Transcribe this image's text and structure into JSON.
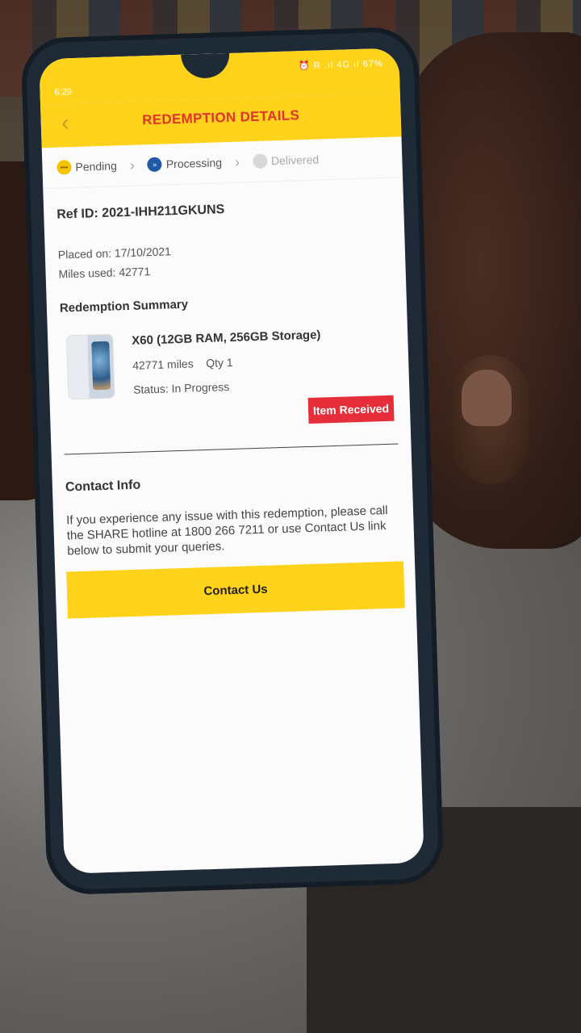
{
  "status_bar": {
    "time": "6:29",
    "icons": "⏰ R .ıl 4G ıl  67%",
    "battery": "67%"
  },
  "header": {
    "title": "REDEMPTION DETAILS",
    "back_icon": "chevron-left-icon"
  },
  "steps": [
    {
      "label": "Pending",
      "state": "complete"
    },
    {
      "label": "Processing",
      "state": "active"
    },
    {
      "label": "Delivered",
      "state": "inactive"
    }
  ],
  "order": {
    "ref": "Ref ID: 2021-IHH211GKUNS",
    "placed_on": "Placed on: 17/10/2021",
    "miles_used": "Miles used: 42771"
  },
  "summary": {
    "section_title": "Redemption Summary",
    "product_name": "X60 (12GB RAM, 256GB Storage)",
    "miles": "42771 miles",
    "qty": "Qty  1",
    "status": "Status: In Progress",
    "badge": "Item Received"
  },
  "contact": {
    "title": "Contact Info",
    "text": "If you experience any issue with this redemption, please call the SHARE hotline at 1800 266 7211 or use Contact Us link below to submit your queries.",
    "button_label": "Contact Us"
  },
  "colors": {
    "brand_yellow": "#ffd21c",
    "title_red": "#e0352b",
    "badge_red": "#e52e3a",
    "processing_blue": "#1e5aa8"
  }
}
